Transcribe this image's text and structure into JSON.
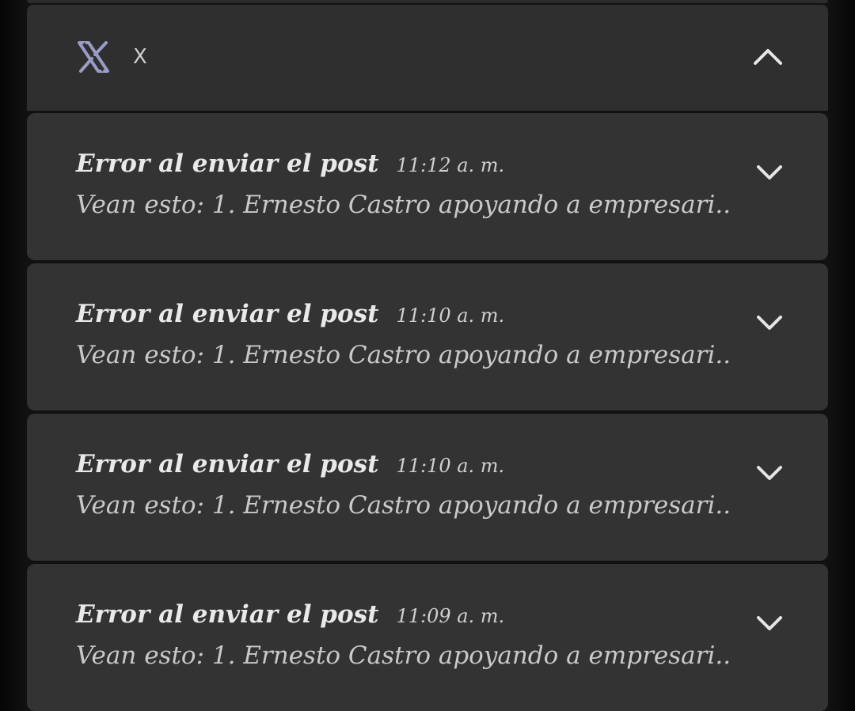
{
  "header": {
    "app_icon": "x-logo-icon",
    "app_name": "X",
    "collapse_icon": "chevron-up-icon"
  },
  "notifications": [
    {
      "title": "Error al enviar el post",
      "time": "11:12 a. m.",
      "body": "Vean esto: 1. Ernesto Castro apoyando a empresari..",
      "expand_icon": "chevron-down-icon"
    },
    {
      "title": "Error al enviar el post",
      "time": "11:10 a. m.",
      "body": "Vean esto: 1. Ernesto Castro apoyando a empresari..",
      "expand_icon": "chevron-down-icon"
    },
    {
      "title": "Error al enviar el post",
      "time": "11:10 a. m.",
      "body": "Vean esto: 1. Ernesto Castro apoyando a empresari..",
      "expand_icon": "chevron-down-icon"
    },
    {
      "title": "Error al enviar el post",
      "time": "11:09 a. m.",
      "body": "Vean esto: 1. Ernesto Castro apoyando a empresari..",
      "expand_icon": "chevron-down-icon"
    }
  ],
  "colors": {
    "card_background": "#333333",
    "header_background": "#2f2f2f",
    "title_text": "#e9e9e9",
    "body_text": "#c9c9c9"
  }
}
